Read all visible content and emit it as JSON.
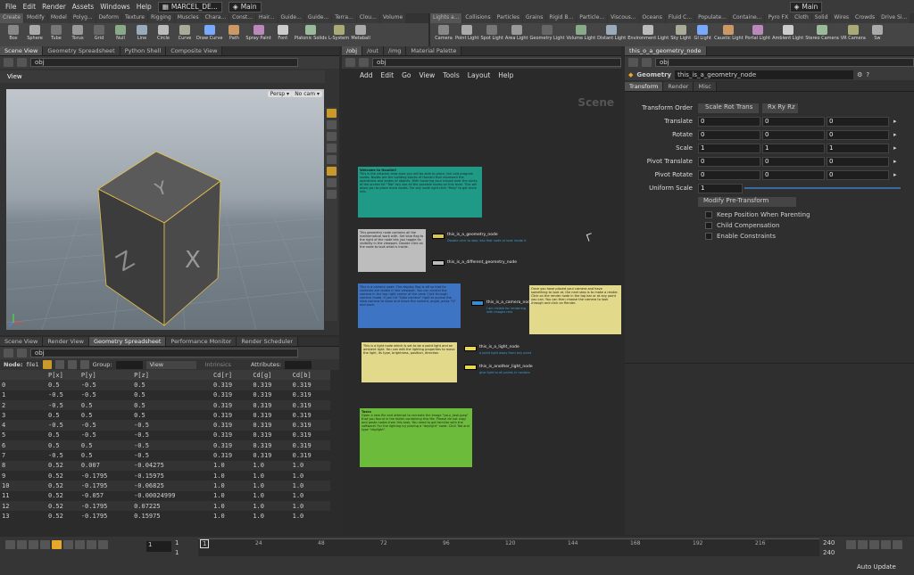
{
  "menubar": {
    "items": [
      "File",
      "Edit",
      "Render",
      "Assets",
      "Windows",
      "Help"
    ],
    "desktop_left": "MARCEL_DE...",
    "desktop_main": "Main",
    "desktop_right": "Main"
  },
  "shelf_tabs_left": [
    "Create",
    "Modify",
    "Model",
    "Polyg...",
    "Deform",
    "Texture",
    "Rigging",
    "Muscles",
    "Chara...",
    "Const...",
    "Hair...",
    "Guide...",
    "Guide...",
    "Terra...",
    "Clou...",
    "Volume"
  ],
  "shelf_tabs_right": [
    "Lights a...",
    "Collisions",
    "Particles",
    "Grains",
    "Rigid B...",
    "Particle...",
    "Viscous...",
    "Oceans",
    "Fluid C...",
    "Populate...",
    "Containe...",
    "Pyro FX",
    "Cloth",
    "Solid",
    "Wires",
    "Crowds",
    "Drive Si..."
  ],
  "shelf_tools_left": [
    "Box",
    "Sphere",
    "Tube",
    "Torus",
    "Grid",
    "Null",
    "Line",
    "Circle",
    "Curve",
    "Draw Curve",
    "Path",
    "Spray Paint",
    "Font",
    "Platonic Solids",
    "L-System",
    "Metaball"
  ],
  "shelf_tools_right": [
    "Camera",
    "Point Light",
    "Spot Light",
    "Area Light",
    "Geometry Light",
    "Volume Light",
    "Distant Light",
    "Environment Light",
    "Sky Light",
    "GI Light",
    "Caustic Light",
    "Portal Light",
    "Ambient Light",
    "Stereo Camera",
    "VR Camera",
    "Sw"
  ],
  "left_tabs": [
    "Scene View",
    "Geometry Spreadsheet",
    "Python Shell",
    "Composite View"
  ],
  "mid_tabs": [
    "/obj",
    "/out",
    "/img",
    "Material Palette"
  ],
  "right_tabs": [
    "this_o_a_geometry_node"
  ],
  "path_obj": "obj",
  "viewport": {
    "title": "View",
    "persp": "Persp",
    "cam": "No cam"
  },
  "netmenu": [
    "Add",
    "Edit",
    "Go",
    "View",
    "Tools",
    "Layout",
    "Help"
  ],
  "network_label": "Scene",
  "stickies": [
    {
      "title": "Welcome to Houdini!",
      "text": "This is the network view area you will be able to place, link and program nodes. Nodes are the building blocks of Houdini that represent the operations and states of objects. With hovering your mouse over the sticks of the screen hit \"Tab\" key see all the possible nodes on this level. This will allow you to place more nodes. For any node right click \"Help\" to get more info."
    },
    {
      "title": "",
      "text": "This geometry node contains all the mathematical work with. Set blue flag to the right of the node lets you toggle its visibility in the viewport. Double click on the node to look what is inside."
    },
    {
      "title": "",
      "text": "This is a camera node. The display flag is off so that its contents are visible in the viewport. You can control the camera in the top right corner of the view. Click through camera mode. If you hit \"Subs camera\" right to access the view camera to show and move the camera, angle, press \"Q\" and save."
    },
    {
      "title": "",
      "text": "Once you have placed your camera and have something to look at, the next step is to make a render. Click on the render node in the top bar or at any point you can. You can then choose the camera to look through and click on Render."
    },
    {
      "title": "",
      "text": "This is a light node which is set to be a point light and an ambient light. You can edit the lighting properties to move the light, its type, brightness, position, direction."
    },
    {
      "title": "Tasks",
      "text": "Open a new file and attempt to recreate the image \"your_task.jpeg\" that you found in the folder containing this file. Please do not copy and paste nodes from this task. You need to get familiar with the software! For the lighting try placing a \"daylight\" node. Click Tab and type \"daylight\"."
    }
  ],
  "nodes": [
    {
      "name": "this_is_a_geometry_node",
      "note": "Double click to step into that node or look inside it"
    },
    {
      "name": "this_is_a_different_geometry_node",
      "note": ""
    },
    {
      "name": "this_is_a_camera_node",
      "note": "I am visible for rendering with images rest"
    },
    {
      "name": "this_is_a_light_node",
      "note": "a point light away from any point"
    },
    {
      "name": "this_is_another_light_node",
      "note": "give light to all points in random"
    }
  ],
  "params": {
    "type_label": "Geometry",
    "node_name": "this_is_a_geometry_node",
    "tabs": [
      "Transform",
      "Render",
      "Misc"
    ],
    "transform_order_label": "Transform Order",
    "transform_order": "Scale Rot Trans",
    "rot_order": "Rx Ry Rz",
    "rows": [
      {
        "label": "Translate",
        "x": "0",
        "y": "0",
        "z": "0"
      },
      {
        "label": "Rotate",
        "x": "0",
        "y": "0",
        "z": "0"
      },
      {
        "label": "Scale",
        "x": "1",
        "y": "1",
        "z": "1"
      },
      {
        "label": "Pivot Translate",
        "x": "0",
        "y": "0",
        "z": "0"
      },
      {
        "label": "Pivot Rotate",
        "x": "0",
        "y": "0",
        "z": "0"
      }
    ],
    "uniform_scale_label": "Uniform Scale",
    "uniform_scale": "1",
    "modify_button": "Modify Pre-Transform",
    "checks": [
      "Keep Position When Parenting",
      "Child Compensation",
      "Enable Constraints"
    ]
  },
  "bottom_tabs": [
    "Scene View",
    "Render View",
    "Geometry Spreadsheet",
    "Performance Monitor",
    "Render Scheduler"
  ],
  "spreadsheet": {
    "node_label": "Node:",
    "node": "file1",
    "group_label": "Group:",
    "view": "View",
    "intrinsics": "Intrinsics",
    "attributes_label": "Attributes:",
    "columns": [
      "",
      "P[x]",
      "P[y]",
      "P[z]",
      "Cd[r]",
      "Cd[g]",
      "Cd[b]"
    ],
    "rows": [
      [
        "0",
        "0.5",
        "-0.5",
        "0.5",
        "0.319",
        "0.319",
        "0.319"
      ],
      [
        "1",
        "-0.5",
        "-0.5",
        "0.5",
        "0.319",
        "0.319",
        "0.319"
      ],
      [
        "2",
        "-0.5",
        "0.5",
        "0.5",
        "0.319",
        "0.319",
        "0.319"
      ],
      [
        "3",
        "0.5",
        "0.5",
        "0.5",
        "0.319",
        "0.319",
        "0.319"
      ],
      [
        "4",
        "-0.5",
        "-0.5",
        "-0.5",
        "0.319",
        "0.319",
        "0.319"
      ],
      [
        "5",
        "0.5",
        "-0.5",
        "-0.5",
        "0.319",
        "0.319",
        "0.319"
      ],
      [
        "6",
        "0.5",
        "0.5",
        "-0.5",
        "0.319",
        "0.319",
        "0.319"
      ],
      [
        "7",
        "-0.5",
        "0.5",
        "-0.5",
        "0.319",
        "0.319",
        "0.319"
      ],
      [
        "8",
        "0.52",
        "0.007",
        "-0.04275",
        "1.0",
        "1.0",
        "1.0"
      ],
      [
        "9",
        "0.52",
        "-0.1795",
        "-0.15975",
        "1.0",
        "1.0",
        "1.0"
      ],
      [
        "10",
        "0.52",
        "-0.1795",
        "-0.06825",
        "1.0",
        "1.0",
        "1.0"
      ],
      [
        "11",
        "0.52",
        "-0.057",
        "-0.00024999",
        "1.0",
        "1.0",
        "1.0"
      ],
      [
        "12",
        "0.52",
        "-0.1795",
        "0.07225",
        "1.0",
        "1.0",
        "1.0"
      ],
      [
        "13",
        "0.52",
        "-0.1795",
        "0.15975",
        "1.0",
        "1.0",
        "1.0"
      ]
    ]
  },
  "timeline": {
    "frame": "1",
    "start": "1",
    "start2": "1",
    "ticks": [
      "24",
      "48",
      "72",
      "96",
      "120",
      "144",
      "168",
      "192",
      "216"
    ],
    "end": "240",
    "end2": "240",
    "auto_update": "Auto Update",
    "current": "1"
  },
  "colors": {
    "teal": "#1f9a87",
    "grey_note": "#bdbdbd",
    "blue_note": "#3d75c4",
    "yellow_note": "#e2d98a",
    "green_note": "#6dbb3a",
    "accent": "#e8a82a"
  }
}
